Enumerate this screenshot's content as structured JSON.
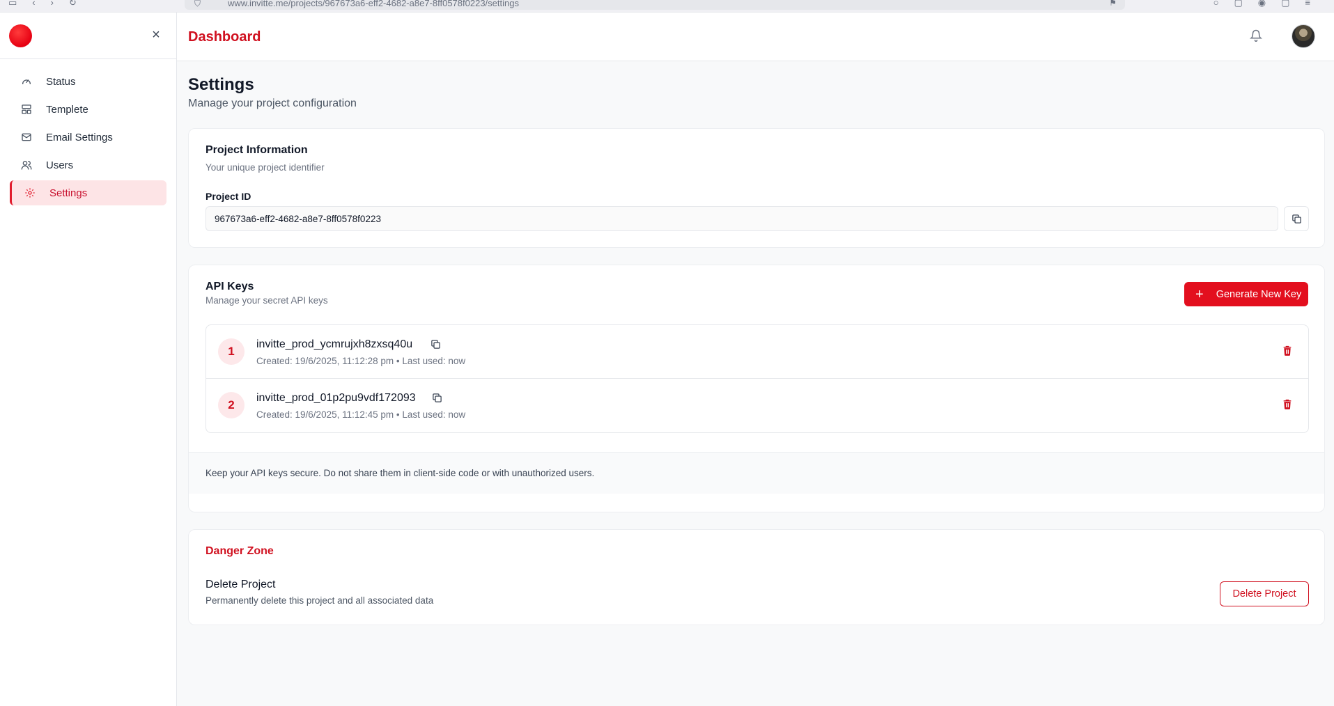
{
  "browser": {
    "url": "www.invitte.me/projects/967673a6-eff2-4682-a8e7-8ff0578f0223/settings"
  },
  "sidebar": {
    "close_label": "×",
    "items": [
      {
        "label": "Status",
        "icon": "gauge-icon"
      },
      {
        "label": "Templete",
        "icon": "layout-icon"
      },
      {
        "label": "Email Settings",
        "icon": "mail-icon"
      },
      {
        "label": "Users",
        "icon": "users-icon"
      },
      {
        "label": "Settings",
        "icon": "gear-icon",
        "active": true
      }
    ]
  },
  "header": {
    "title": "Dashboard"
  },
  "page": {
    "title": "Settings",
    "subtitle": "Manage your project configuration"
  },
  "project_info": {
    "title": "Project Information",
    "subtitle": "Your unique project identifier",
    "field_label": "Project ID",
    "project_id": "967673a6-eff2-4682-a8e7-8ff0578f0223"
  },
  "api_keys": {
    "title": "API Keys",
    "subtitle": "Manage your secret API keys",
    "generate_label": "Generate New Key",
    "keys": [
      {
        "index": "1",
        "name": "invitte_prod_ycmrujxh8zxsq40u",
        "meta": "Created: 19/6/2025, 11:12:28 pm • Last used: now"
      },
      {
        "index": "2",
        "name": "invitte_prod_01p2pu9vdf172093",
        "meta": "Created: 19/6/2025, 11:12:45 pm • Last used: now"
      }
    ],
    "note": "Keep your API keys secure. Do not share them in client-side code or with unauthorized users."
  },
  "danger_zone": {
    "title": "Danger Zone",
    "delete_title": "Delete Project",
    "delete_subtitle": "Permanently delete this project and all associated data",
    "delete_button": "Delete Project"
  },
  "colors": {
    "accent": "#e30f1e",
    "accent_text": "#d0101f",
    "active_bg": "#fde4e6"
  }
}
